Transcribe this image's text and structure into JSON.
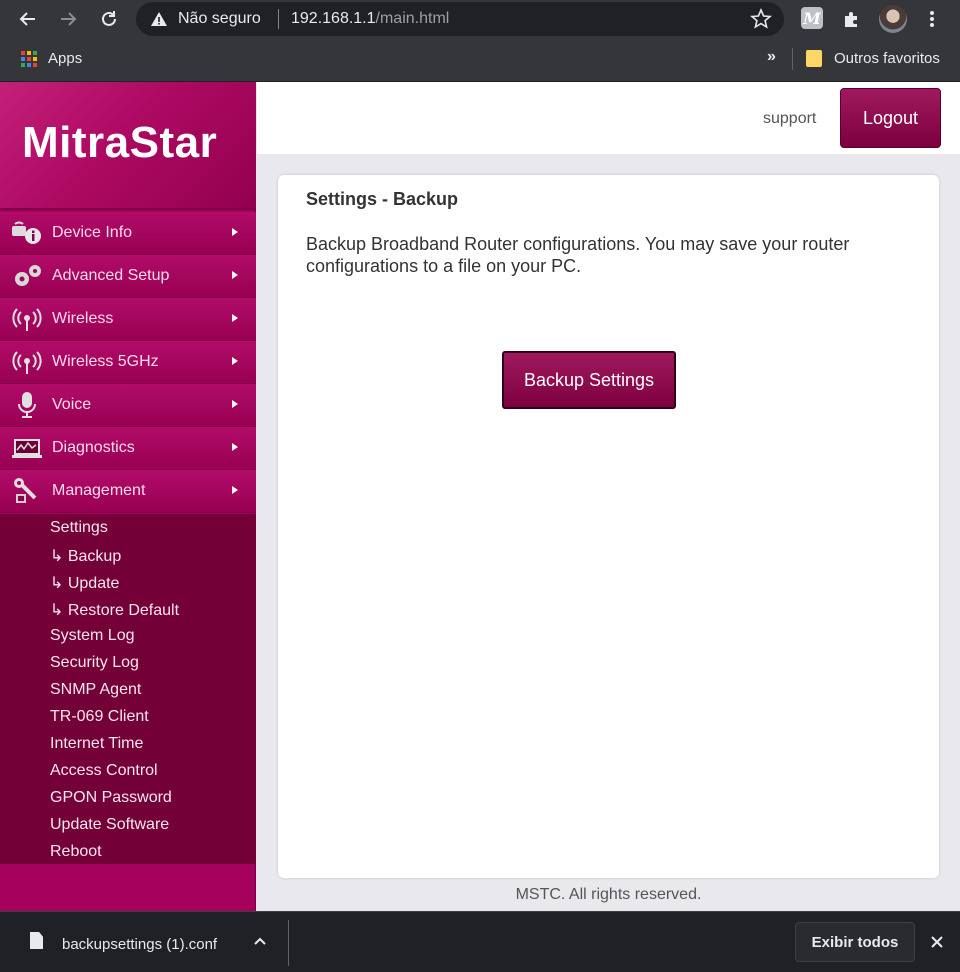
{
  "browser": {
    "security_label": "Não seguro",
    "url_host": "192.168.1.1",
    "url_path": "/main.html",
    "extension_letter": "M",
    "bookmarks": {
      "apps_label": "Apps",
      "more_label": "»",
      "other_favorites": "Outros favoritos"
    }
  },
  "router": {
    "logo": "MitraStar",
    "support_label": "support",
    "logout_label": "Logout",
    "accent_color": "#a4005c",
    "menu": [
      {
        "label": "Device Info",
        "icon": "device-info-icon"
      },
      {
        "label": "Advanced Setup",
        "icon": "gears-icon"
      },
      {
        "label": "Wireless",
        "icon": "wireless-icon"
      },
      {
        "label": "Wireless 5GHz",
        "icon": "wireless-icon"
      },
      {
        "label": "Voice",
        "icon": "microphone-icon"
      },
      {
        "label": "Diagnostics",
        "icon": "diagnostics-icon"
      },
      {
        "label": "Management",
        "icon": "wrench-icon"
      }
    ],
    "submenu": [
      "Settings",
      "↳ Backup",
      "↳ Update",
      "↳ Restore Default",
      "System Log",
      "Security Log",
      "SNMP Agent",
      "TR-069 Client",
      "Internet Time",
      "Access Control",
      "GPON Password",
      "Update Software",
      "Reboot"
    ],
    "content": {
      "title": "Settings - Backup",
      "description": "Backup Broadband Router configurations. You may save your router configurations to a file on your PC.",
      "button_label": "Backup Settings"
    },
    "footer": "MSTC. All rights reserved."
  },
  "download_bar": {
    "file_name": "backupsettings (1).conf",
    "show_all_label": "Exibir todos"
  }
}
